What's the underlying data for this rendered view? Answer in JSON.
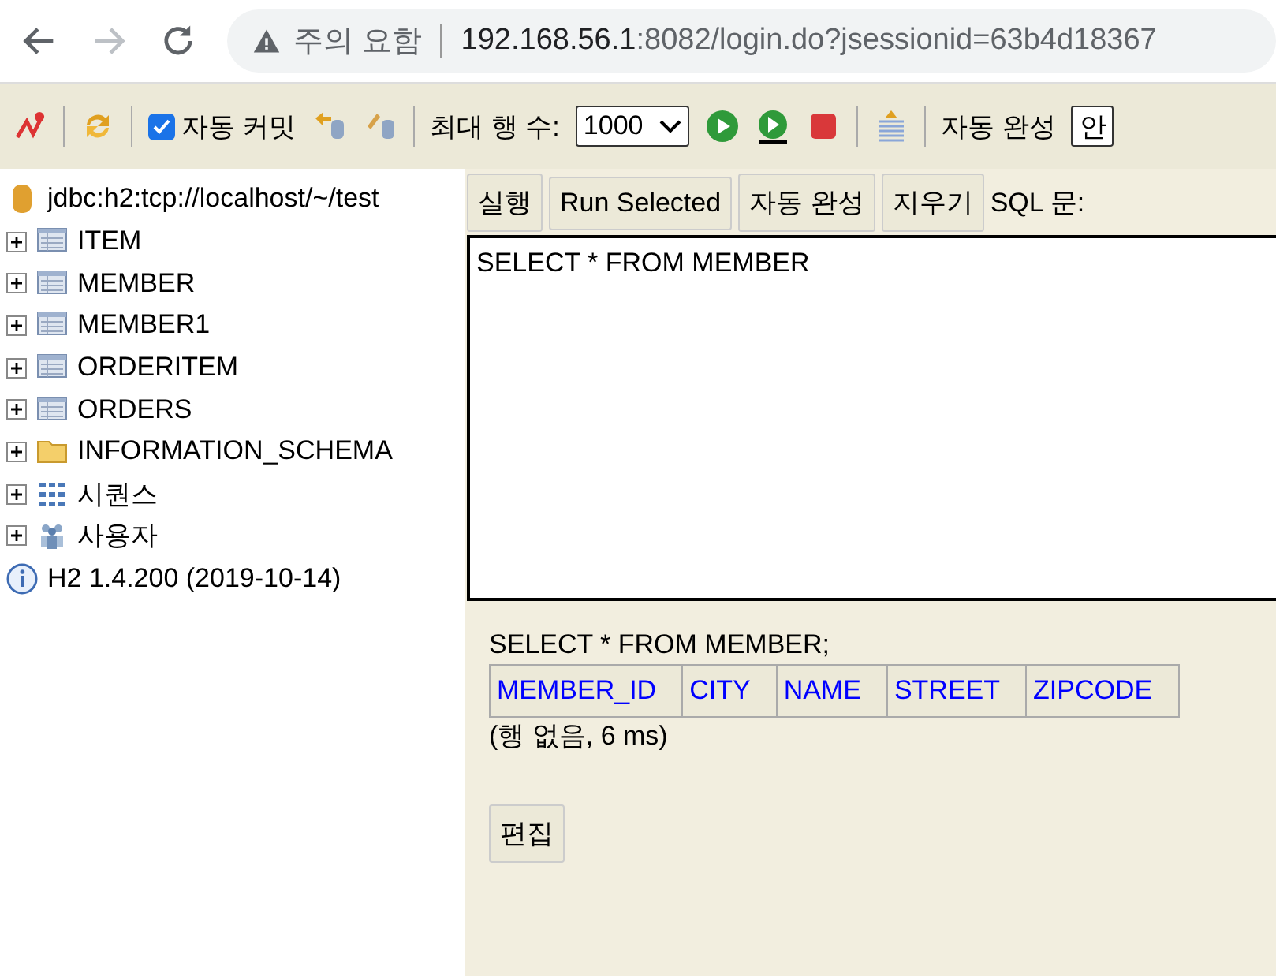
{
  "browser": {
    "warning": "주의 요함",
    "url_host": "192.168.56.1",
    "url_rest": ":8082/login.do?jsessionid=63b4d18367"
  },
  "toolbar": {
    "auto_commit": {
      "label": "자동 커밋",
      "checked": true
    },
    "max_rows": {
      "label": "최대 행 수:",
      "value": "1000"
    },
    "autocomplete": {
      "label": "자동 완성",
      "value": "안"
    }
  },
  "tree": {
    "connection": "jdbc:h2:tcp://localhost/~/test",
    "items": [
      {
        "kind": "table",
        "label": "ITEM",
        "expanded": false
      },
      {
        "kind": "table",
        "label": "MEMBER",
        "expanded": false
      },
      {
        "kind": "table",
        "label": "MEMBER1",
        "expanded": false
      },
      {
        "kind": "table",
        "label": "ORDERITEM",
        "expanded": false
      },
      {
        "kind": "table",
        "label": "ORDERS",
        "expanded": false
      },
      {
        "kind": "folder",
        "label": "INFORMATION_SCHEMA",
        "expanded": false
      },
      {
        "kind": "sequence",
        "label": "시퀀스",
        "expanded": false
      },
      {
        "kind": "users",
        "label": "사용자",
        "expanded": false
      }
    ],
    "version": "H2 1.4.200 (2019-10-14)"
  },
  "query_buttons": [
    "실행",
    "Run Selected",
    "자동 완성",
    "지우기"
  ],
  "sql_label": "SQL 문:",
  "sql_editor": {
    "value": "SELECT * FROM MEMBER"
  },
  "result": {
    "query": "SELECT * FROM MEMBER;",
    "columns": [
      "MEMBER_ID",
      "CITY",
      "NAME",
      "STREET",
      "ZIPCODE"
    ],
    "status": "(행 없음, 6 ms)",
    "edit_button": "편집"
  }
}
